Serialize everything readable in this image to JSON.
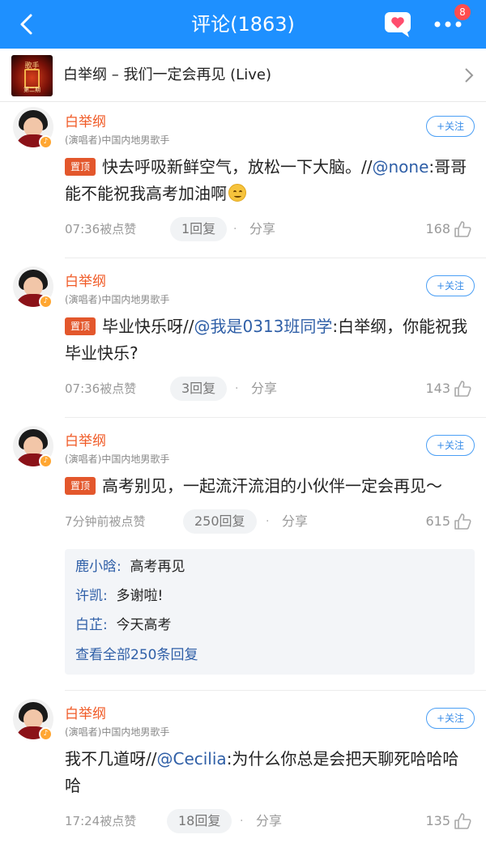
{
  "header": {
    "title": "评论(1863)",
    "badge": "8",
    "accent": "#1e90ff"
  },
  "song": {
    "title": "白举纲 – 我们一定会再见 (Live)",
    "cover_text": "歌手",
    "cover_small": "第二期"
  },
  "follow_label": "+关注",
  "pin_label": "置顶",
  "comments": [
    {
      "name": "白举纲",
      "tag": "(演唱者)中国内地男歌手",
      "text": "快去呼吸新鲜空气，放松一下大脑。//",
      "mention": "@none",
      "rest": ":哥哥 能不能祝我高考加油啊",
      "time": "07:36被点赞",
      "replies": "1回复",
      "share": "分享",
      "likes": "168"
    },
    {
      "name": "白举纲",
      "tag": "(演唱者)中国内地男歌手",
      "text": "毕业快乐呀//",
      "mention": "@我是0313班同学",
      "rest": ":白举纲，你能祝我毕业快乐?",
      "time": "07:36被点赞",
      "replies": "3回复",
      "share": "分享",
      "likes": "143"
    },
    {
      "name": "白举纲",
      "tag": "(演唱者)中国内地男歌手",
      "text": "高考别见，一起流汗流泪的小伙伴一定会再见～",
      "time": "7分钟前被点赞",
      "replies": "250回复",
      "share": "分享",
      "likes": "615",
      "sub_replies": [
        {
          "user": "鹿小晗:",
          "text": "高考再见"
        },
        {
          "user": "许凯:",
          "text": "多谢啦!"
        },
        {
          "user": "白芷:",
          "text": "今天高考"
        }
      ],
      "view_all": "查看全部250条回复"
    },
    {
      "name": "白举纲",
      "tag": "(演唱者)中国内地男歌手",
      "text": "我不几道呀//",
      "mention": "@Cecilia",
      "rest": ":为什么你总是会把天聊死哈哈哈哈",
      "time": "17:24被点赞",
      "replies": "18回复",
      "share": "分享",
      "likes": "135"
    }
  ]
}
